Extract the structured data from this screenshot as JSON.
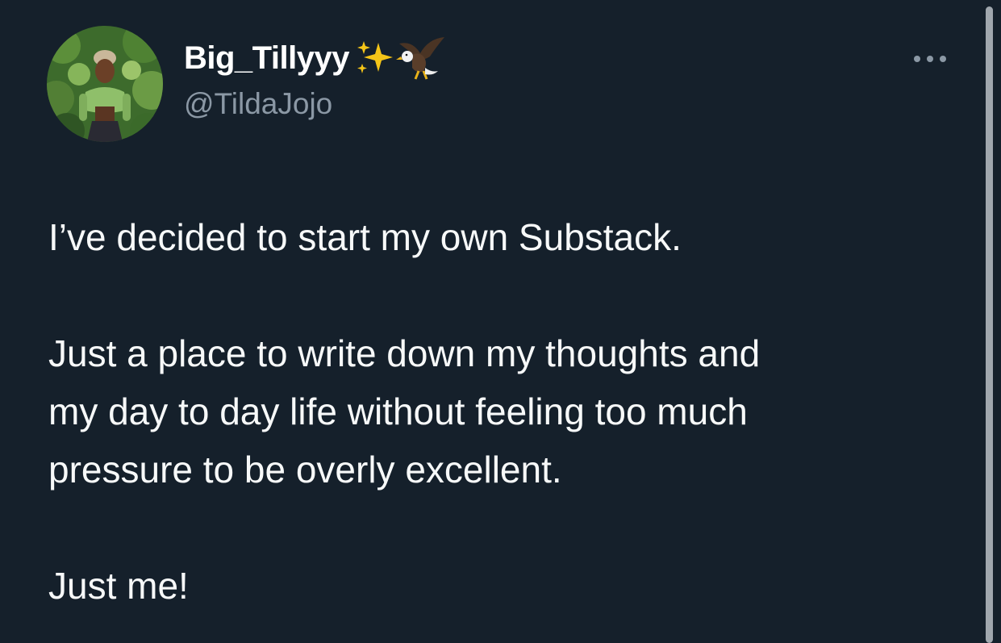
{
  "user": {
    "display_name": "Big_Tillyyy",
    "username": "@TildaJojo",
    "name_emojis": [
      "sparkles-icon",
      "eagle-icon"
    ]
  },
  "tweet": {
    "line1": "I’ve decided to start my own Substack.",
    "line2": "Just a place to write down my thoughts and",
    "line3": "my day to day life without feeling too much",
    "line4": "pressure to be overly excellent.",
    "line5": "Just me!"
  },
  "colors": {
    "background": "#15202b",
    "text": "#f7f9f9",
    "secondary_text": "#8b98a5"
  }
}
